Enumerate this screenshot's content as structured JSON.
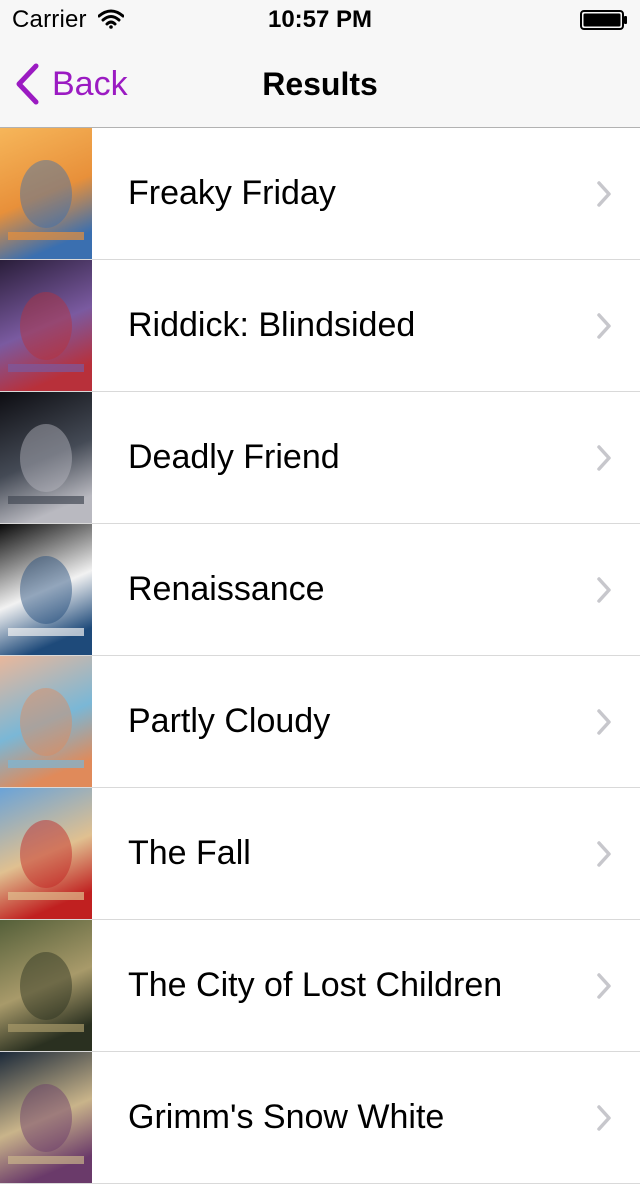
{
  "status_bar": {
    "carrier": "Carrier",
    "time": "10:57 PM"
  },
  "nav": {
    "back_label": "Back",
    "title": "Results",
    "accent_color": "#9b1bc2"
  },
  "results": [
    {
      "title": "Freaky Friday",
      "poster_colors": [
        "#f6b65a",
        "#e8903a",
        "#3a6fb0"
      ]
    },
    {
      "title": "Riddick: Blindsided",
      "poster_colors": [
        "#2a1e3a",
        "#7a5aa0",
        "#b8303a"
      ]
    },
    {
      "title": "Deadly Friend",
      "poster_colors": [
        "#0d0d12",
        "#444a55",
        "#b9b9c0"
      ]
    },
    {
      "title": "Renaissance",
      "poster_colors": [
        "#0a0a0a",
        "#f2f2f2",
        "#1e4a7a"
      ]
    },
    {
      "title": "Partly Cloudy",
      "poster_colors": [
        "#e9b79b",
        "#7ab7d6",
        "#e08a5a"
      ]
    },
    {
      "title": "The Fall",
      "poster_colors": [
        "#6aa3d8",
        "#e0c090",
        "#c02020"
      ]
    },
    {
      "title": "The City of Lost Children",
      "poster_colors": [
        "#55603a",
        "#a89a6a",
        "#2a3020"
      ]
    },
    {
      "title": "Grimm's Snow White",
      "poster_colors": [
        "#1c2a3a",
        "#c9b48a",
        "#6a3a6a"
      ]
    }
  ]
}
